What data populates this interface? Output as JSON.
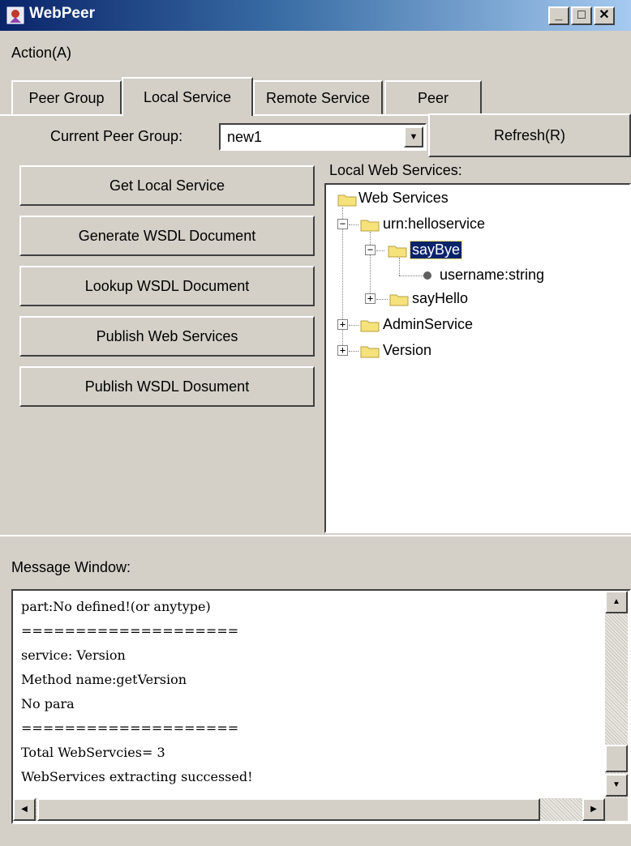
{
  "window": {
    "title": "WebPeer"
  },
  "menu": {
    "action": "Action(A)"
  },
  "tabs": [
    {
      "label": "Peer Group"
    },
    {
      "label": "Local Service"
    },
    {
      "label": "Remote Service"
    },
    {
      "label": "Peer"
    }
  ],
  "peer_group": {
    "label": "Current Peer Group:",
    "value": "new1",
    "refresh_label": "Refresh(R)"
  },
  "actions": [
    {
      "label": "Get Local Service"
    },
    {
      "label": "Generate WSDL Document"
    },
    {
      "label": "Lookup WSDL Document"
    },
    {
      "label": "Publish Web Services"
    },
    {
      "label": "Publish WSDL Dosument"
    }
  ],
  "tree": {
    "label": "Local Web Services:",
    "root": "Web Services",
    "service1": "urn:helloservice",
    "method1": "sayBye",
    "param1": "username:string",
    "method2": "sayHello",
    "service2": "AdminService",
    "service3": "Version"
  },
  "messages": {
    "label": "Message Window:",
    "lines": [
      "part:No defined!(or anytype)",
      "====================",
      "service: Version",
      "Method name:getVersion",
      "No para",
      "====================",
      "Total WebServcies= 3",
      "WebServices extracting successed!"
    ]
  },
  "colors": {
    "titlebar": "#0a246a",
    "selection": "#0a246a",
    "folder": "#f5e27a"
  }
}
